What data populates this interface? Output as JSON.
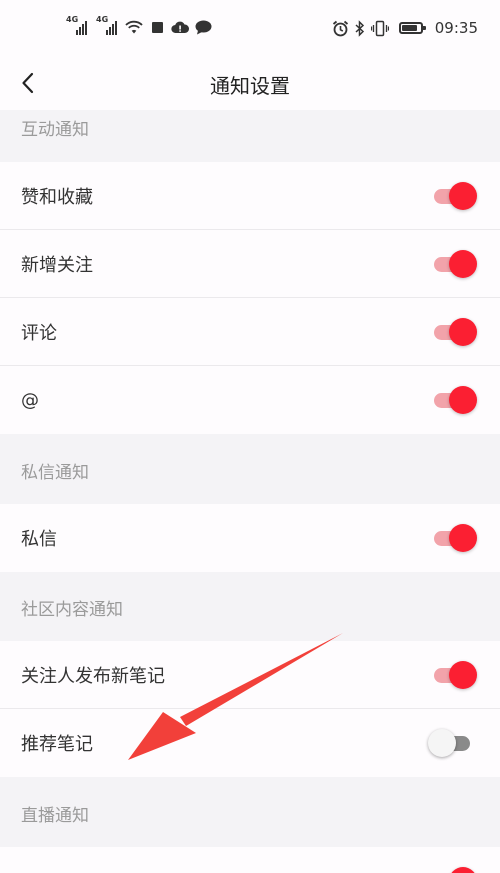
{
  "status_bar": {
    "network1": "4G",
    "network2": "4G",
    "time": "09:35"
  },
  "nav": {
    "title": "通知设置"
  },
  "sections": {
    "interaction": "互动通知",
    "private_message": "私信通知",
    "community": "社区内容通知",
    "live": "直播通知"
  },
  "rows": {
    "likes_and_favorites": {
      "label": "赞和收藏",
      "enabled": true
    },
    "new_followers": {
      "label": "新增关注",
      "enabled": true
    },
    "comments": {
      "label": "评论",
      "enabled": true
    },
    "mentions": {
      "label": "@",
      "enabled": true
    },
    "private_messages": {
      "label": "私信",
      "enabled": true
    },
    "followed_posts": {
      "label": "关注人发布新笔记",
      "enabled": true
    },
    "recommended_notes": {
      "label": "推荐笔记",
      "enabled": false
    },
    "live_reminder": {
      "enabled": true
    }
  },
  "colors": {
    "accent": "#fb1f32",
    "accent_track": "#f2a3aa",
    "annotation_arrow": "#f2403a"
  },
  "icons": {
    "back": "chevron-left-icon",
    "alarm": "alarm-icon",
    "bluetooth": "bluetooth-icon",
    "vibrate": "vibrate-icon",
    "battery": "battery-icon",
    "wifi": "wifi-icon"
  }
}
